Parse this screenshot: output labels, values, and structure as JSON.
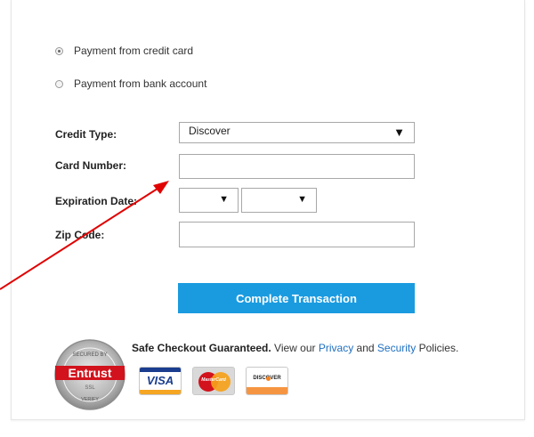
{
  "payment_options": [
    {
      "label": "Payment from credit card",
      "selected": true
    },
    {
      "label": "Payment from bank account",
      "selected": false
    }
  ],
  "form": {
    "credit_type_label": "Credit Type:",
    "credit_type_value": "Discover",
    "card_number_label": "Card Number:",
    "card_number_value": "",
    "expiration_label": "Expiration Date:",
    "exp_month_value": "",
    "exp_year_value": "",
    "zip_label": "Zip Code:",
    "zip_value": ""
  },
  "submit_label": "Complete Transaction",
  "footer": {
    "safe_text": "Safe Checkout Guaranteed.",
    "view_text": " View our ",
    "privacy": "Privacy",
    "and": " and ",
    "security": "Security",
    "policies": " Policies."
  },
  "seal": {
    "top_text": "SECURED BY",
    "brand": "Entrust",
    "sub": "SSL",
    "bottom_text": "VERIFY"
  },
  "cards": [
    {
      "name": "VISA"
    },
    {
      "name": "MasterCard"
    },
    {
      "name": "DISCOVER"
    }
  ],
  "colors": {
    "accent": "#1a9be0",
    "topbar": "#1b5d8f",
    "arrow": "#e00000",
    "link": "#1e6fbf"
  }
}
